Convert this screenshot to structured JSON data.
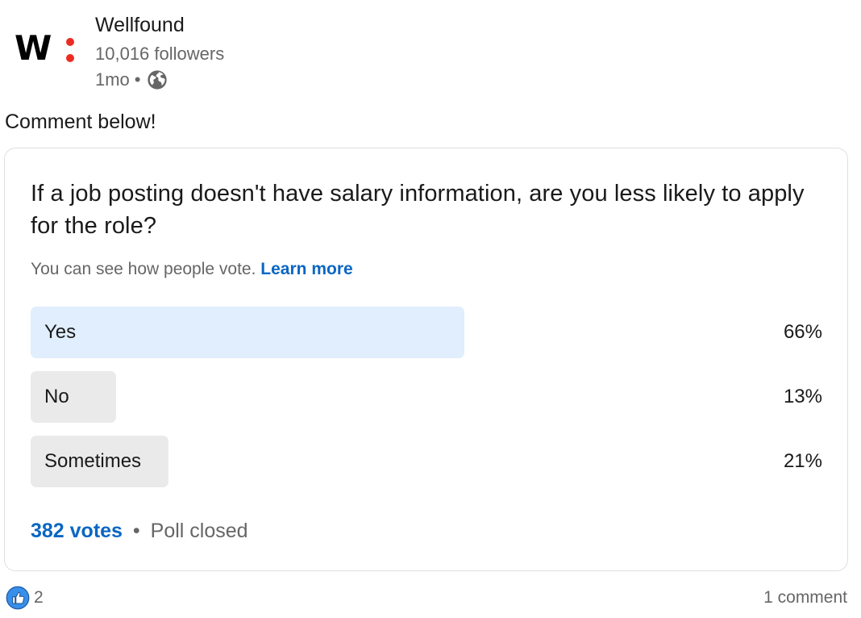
{
  "post": {
    "author": {
      "name": "Wellfound",
      "logo_text": "W",
      "followers": "10,016 followers",
      "time": "1mo",
      "visibility_icon": "globe-icon"
    },
    "text": "Comment below!"
  },
  "poll": {
    "question": "If a job posting doesn't have salary information, are you less likely to apply for the role?",
    "notice": "You can see how people vote.",
    "learn_more": "Learn more",
    "options": [
      {
        "label": "Yes",
        "percent_label": "66%",
        "percent": 66,
        "winner": true
      },
      {
        "label": "No",
        "percent_label": "13%",
        "percent": 13,
        "winner": false
      },
      {
        "label": "Sometimes",
        "percent_label": "21%",
        "percent": 21,
        "winner": false
      }
    ],
    "votes": "382 votes",
    "status": "Poll closed"
  },
  "social": {
    "reaction_icon": "like-icon",
    "reaction_count": "2",
    "comments": "1 comment"
  },
  "colors": {
    "link_blue": "#0a66c2",
    "winner_bar": "#e0eefd",
    "option_bar": "#eaeaea",
    "logo_dot": "#ec2c22"
  }
}
